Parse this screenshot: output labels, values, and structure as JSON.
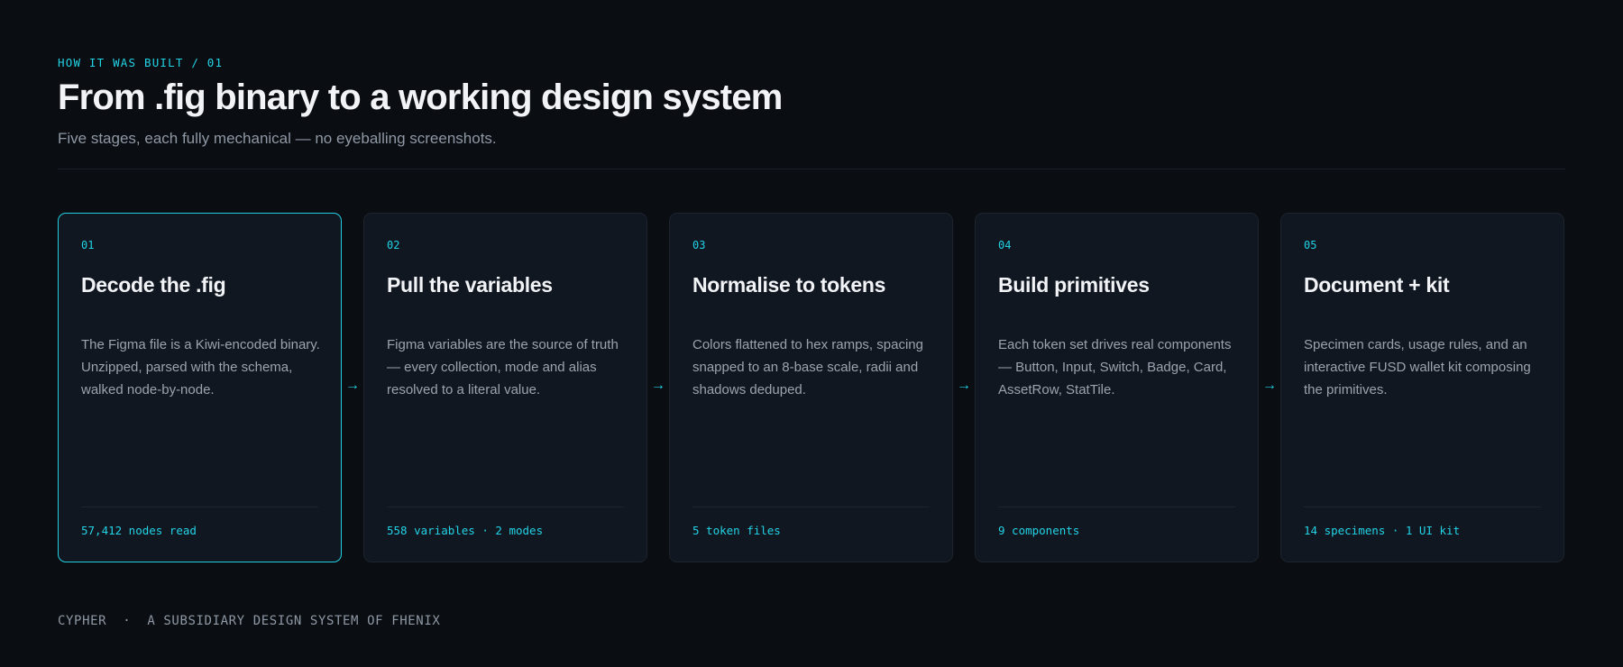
{
  "header": {
    "eyebrow": "HOW IT WAS BUILT / 01",
    "title": "From .fig binary to a working design system",
    "subtitle": "Five stages, each fully mechanical — no eyeballing screenshots."
  },
  "stages": [
    {
      "number": "01",
      "title": "Decode the .fig",
      "description": "The Figma file is a Kiwi-encoded binary. Unzipped, parsed with the schema, walked node-by-node.",
      "stat": "57,412 nodes read",
      "active": true
    },
    {
      "number": "02",
      "title": "Pull the variables",
      "description": "Figma variables are the source of truth — every collection, mode and alias resolved to a literal value.",
      "stat": "558 variables · 2 modes",
      "active": false
    },
    {
      "number": "03",
      "title": "Normalise to tokens",
      "description": "Colors flattened to hex ramps, spacing snapped to an 8-base scale, radii and shadows deduped.",
      "stat": "5 token files",
      "active": false
    },
    {
      "number": "04",
      "title": "Build primitives",
      "description": "Each token set drives real components — Button, Input, Switch, Badge, Card, AssetRow, StatTile.",
      "stat": "9 components",
      "active": false
    },
    {
      "number": "05",
      "title": "Document + kit",
      "description": "Specimen cards, usage rules, and an interactive FUSD wallet kit composing the primitives.",
      "stat": "14 specimens · 1 UI kit",
      "active": false
    }
  ],
  "arrow_glyph": "→",
  "footer": {
    "brand": "CYPHER",
    "separator": "·",
    "tagline": "A SUBSIDIARY DESIGN SYSTEM OF FHENIX"
  },
  "colors": {
    "background": "#0a0d11",
    "card": "#111720",
    "accent": "#22d3e6",
    "border": "#1d242e"
  }
}
